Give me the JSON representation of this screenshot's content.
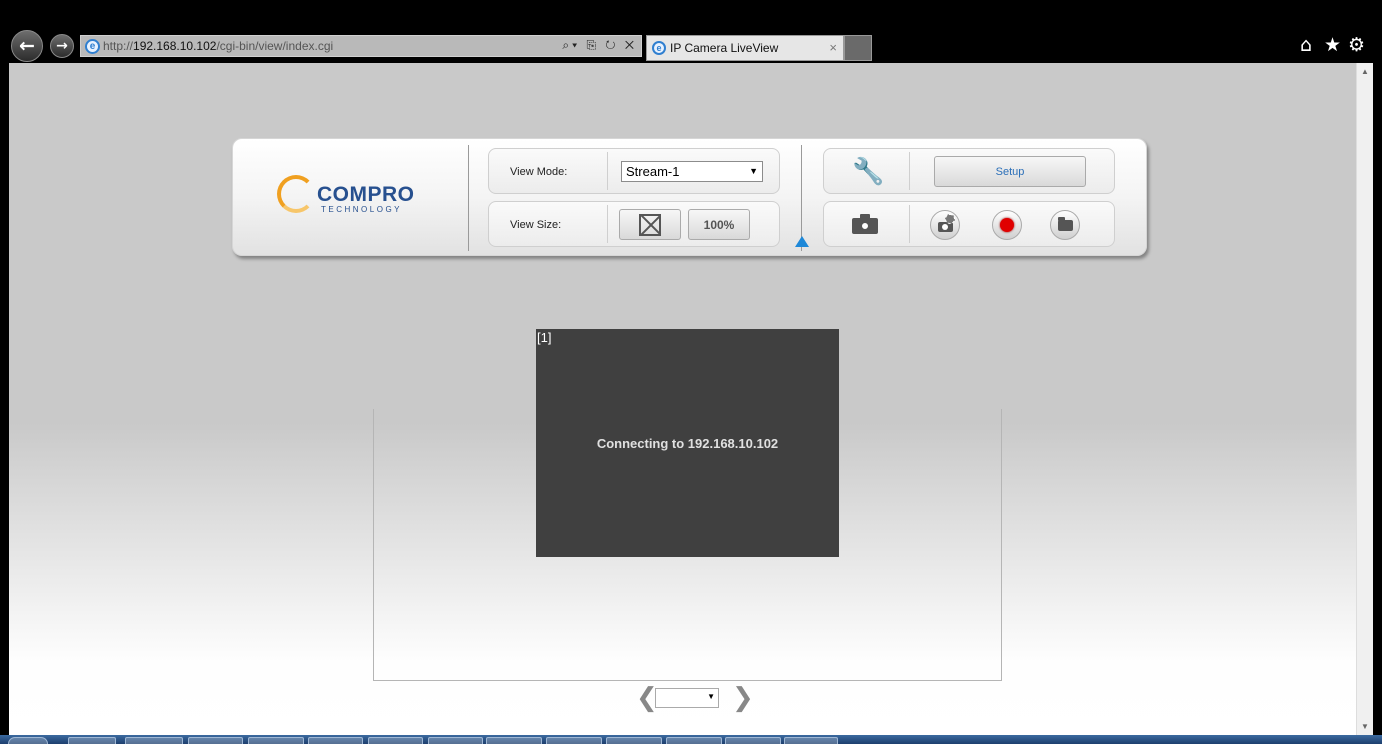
{
  "browser": {
    "url_prefix": "http://",
    "url_host": "192.168.10.102",
    "url_path": "/cgi-bin/view/index.cgi",
    "address_tools": "⌕▾ ⎘ ↻ ✕",
    "ie_glyph": "e",
    "tab_title": "IP Camera LiveView",
    "tab_close": "×",
    "back_glyph": "←",
    "forward_glyph": "→",
    "home_glyph": "⌂",
    "favorites_glyph": "★",
    "tools_glyph": "⚙"
  },
  "logo": {
    "name": "COMPRO",
    "sub": "TECHNOLOGY",
    "brand_color": "#27508f",
    "ring_color": "#f0a020"
  },
  "controls": {
    "view_mode_label": "View Mode:",
    "view_mode_value": "Stream-1",
    "view_size_label": "View Size:",
    "zoom_label": "100%",
    "setup_label": "Setup",
    "tools_glyph": "🔧"
  },
  "video": {
    "index_label": "[1]",
    "status_message": "Connecting to 192.168.10.102",
    "background_color": "#404040"
  },
  "pager": {
    "prev_glyph": "❮",
    "next_glyph": "❯"
  },
  "icons": {
    "record_color": "#e00000",
    "marker_color": "#1e88d8"
  }
}
